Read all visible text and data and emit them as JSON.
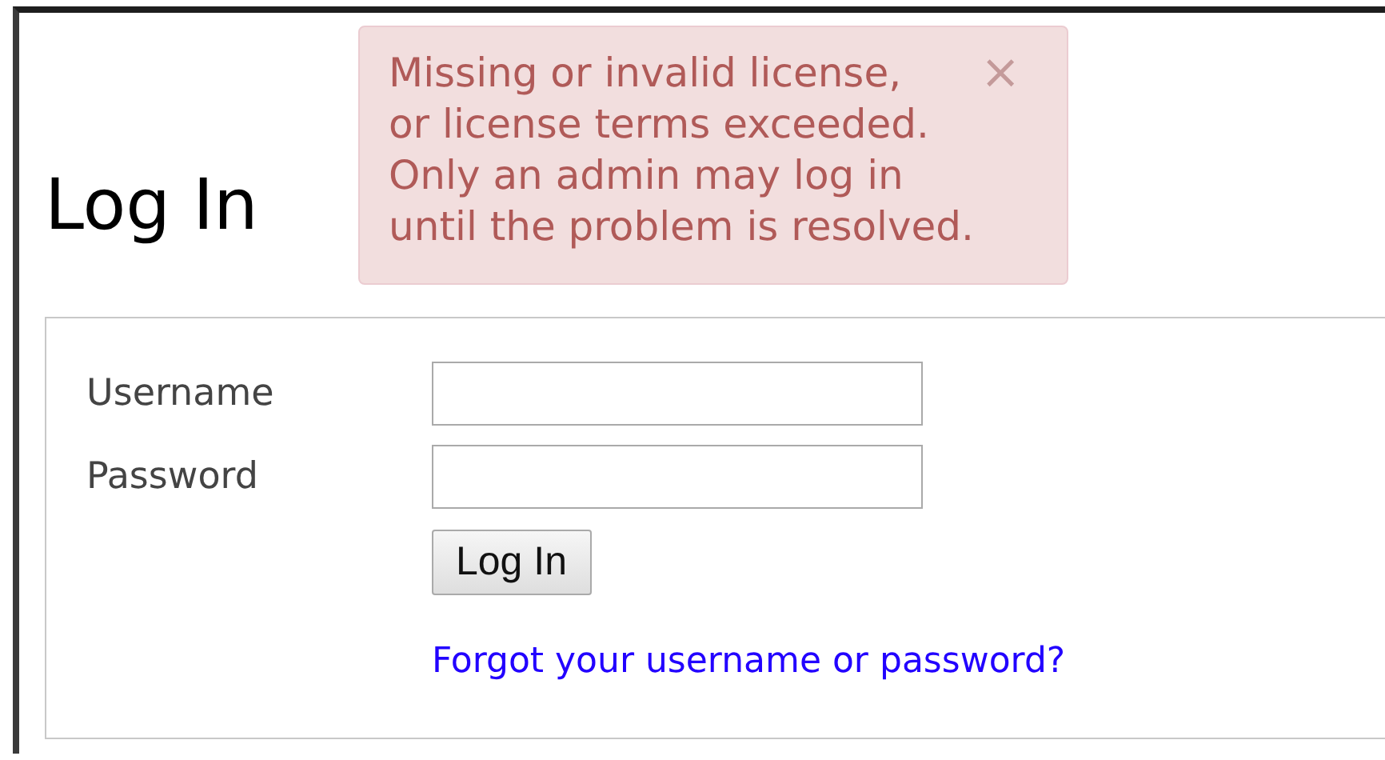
{
  "heading": "Log In",
  "alert": {
    "message": "Missing or invalid license,\nor license terms exceeded.\nOnly an admin may log in\nuntil the problem is resolved.",
    "close": "×"
  },
  "form": {
    "fields": [
      {
        "label": "Username"
      },
      {
        "label": "Password"
      }
    ],
    "submit": "Log In",
    "forgot_link": "Forgot your username or password?"
  }
}
